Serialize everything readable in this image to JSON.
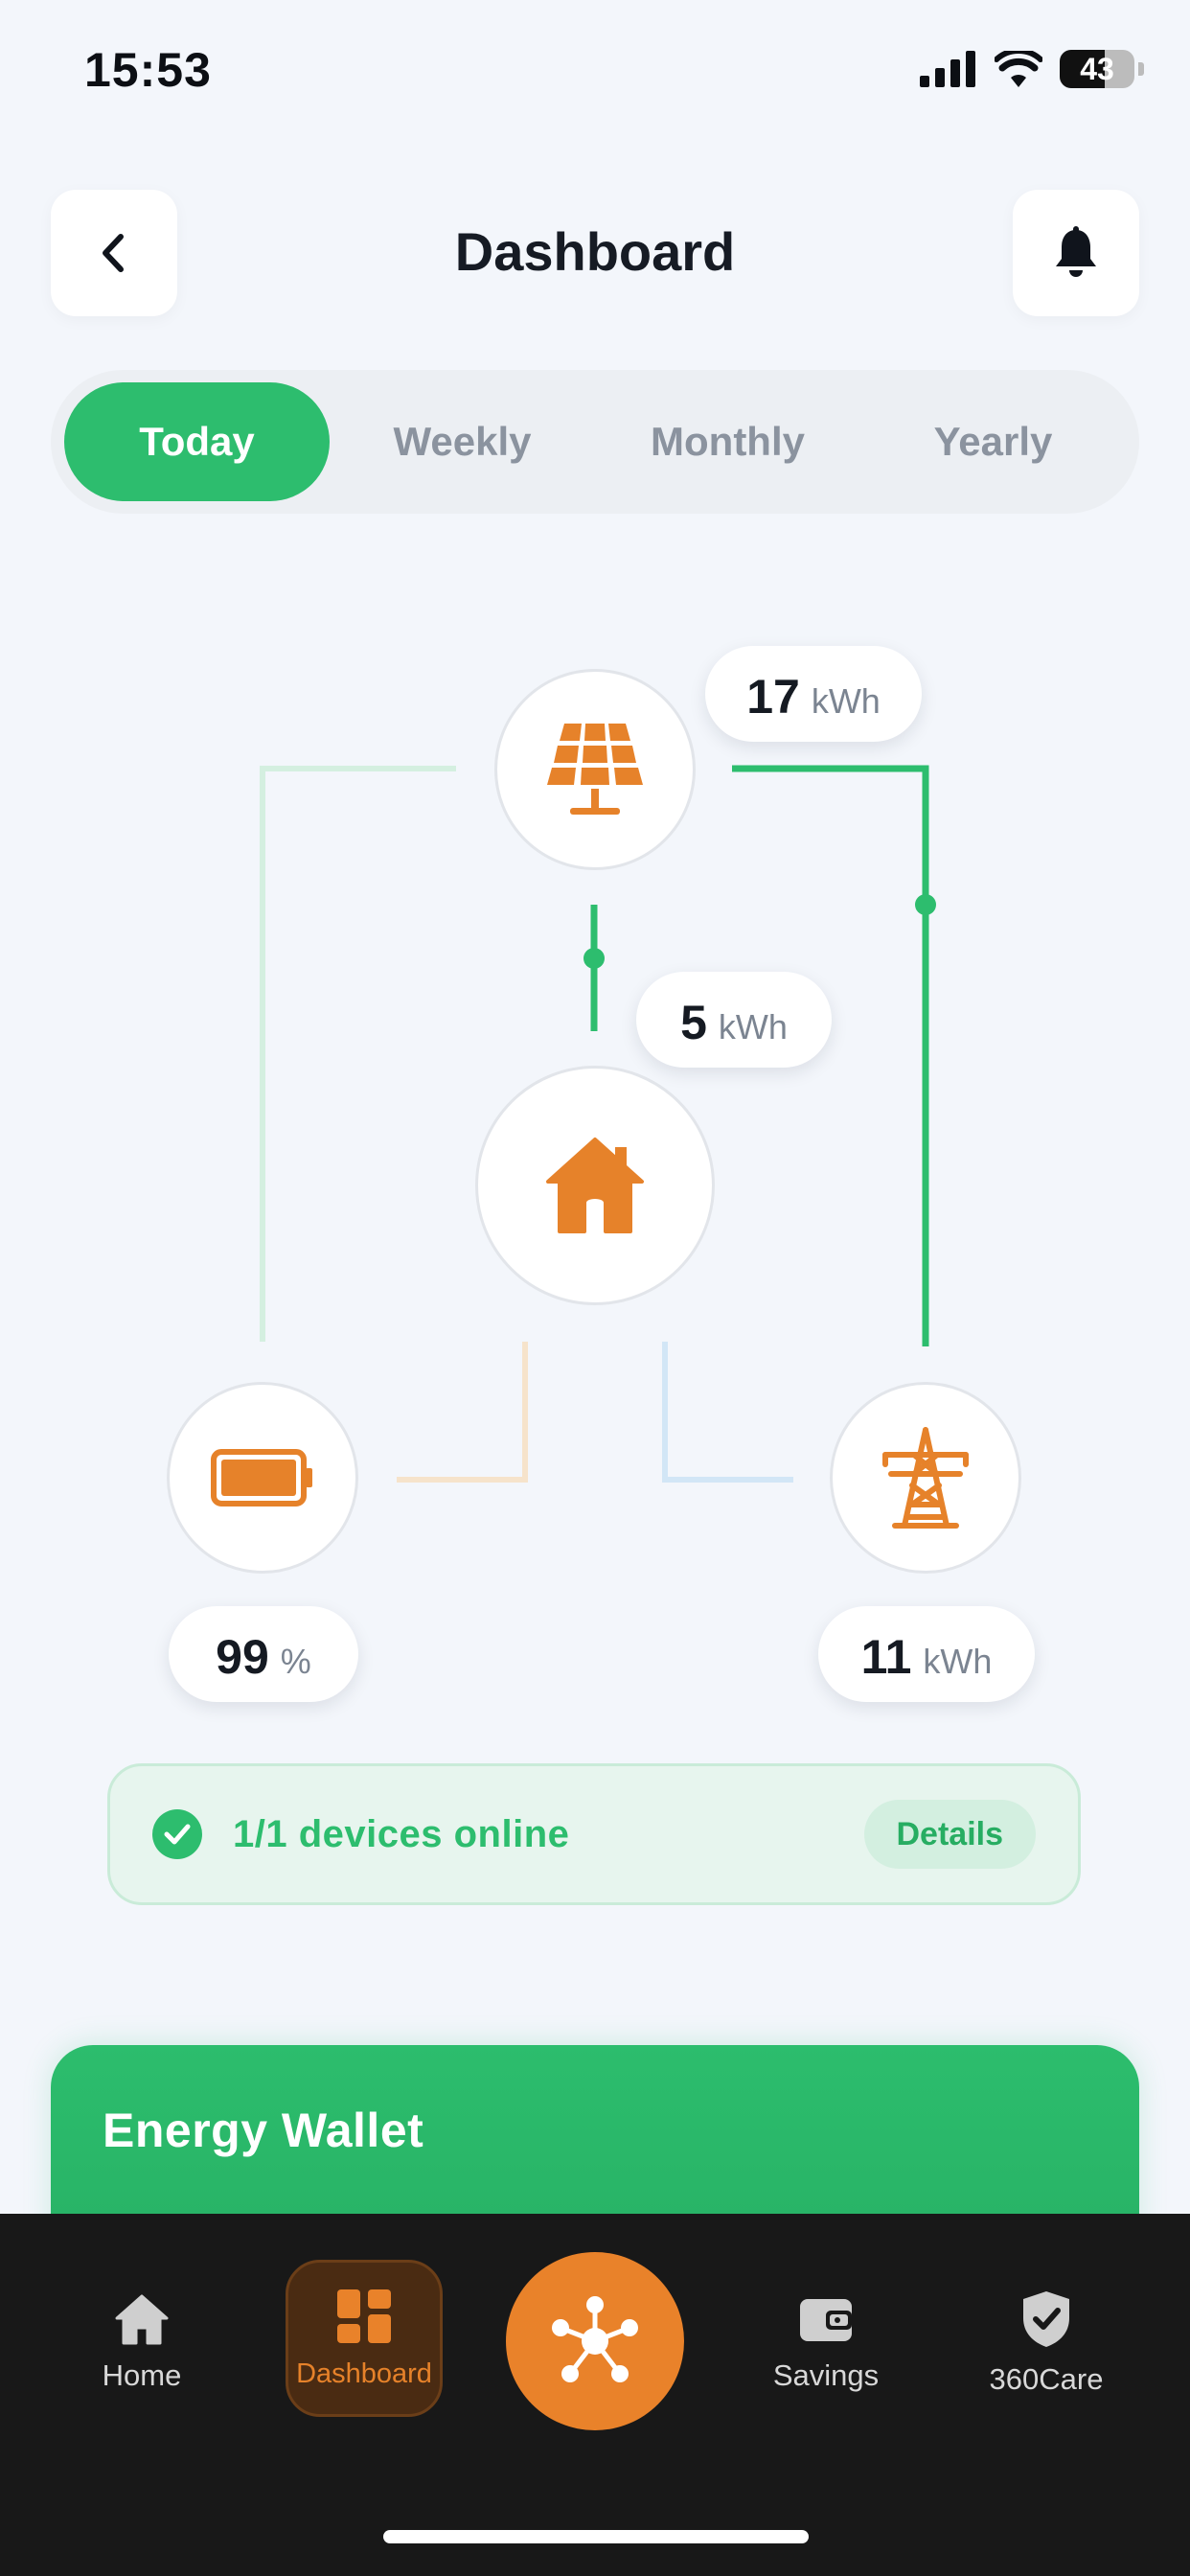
{
  "status_bar": {
    "time": "15:53",
    "battery": "43"
  },
  "header": {
    "title": "Dashboard"
  },
  "tabs": [
    {
      "label": "Today",
      "active": true
    },
    {
      "label": "Weekly",
      "active": false
    },
    {
      "label": "Monthly",
      "active": false
    },
    {
      "label": "Yearly",
      "active": false
    }
  ],
  "energy_flow": {
    "solar": {
      "value": "17",
      "unit": "kWh",
      "icon": "solar-panel-icon"
    },
    "home": {
      "value": "5",
      "unit": "kWh",
      "icon": "house-icon"
    },
    "battery": {
      "value": "99",
      "unit": "%",
      "icon": "battery-icon"
    },
    "grid": {
      "value": "11",
      "unit": "kWh",
      "icon": "power-tower-icon"
    }
  },
  "devices": {
    "text": "1/1 devices online",
    "details_label": "Details"
  },
  "wallet": {
    "title": "Energy Wallet"
  },
  "bottom_nav": [
    {
      "label": "Home",
      "icon": "home-icon"
    },
    {
      "label": "Dashboard",
      "icon": "dashboard-icon",
      "active": true
    },
    {
      "label": "",
      "icon": "network-hub-icon"
    },
    {
      "label": "Savings",
      "icon": "wallet-icon"
    },
    {
      "label": "360Care",
      "icon": "shield-check-icon"
    }
  ],
  "colors": {
    "accent_green": "#2dbd6e",
    "accent_orange": "#e9822a",
    "background": "#f3f6fb",
    "tab_bar": "#181818"
  }
}
